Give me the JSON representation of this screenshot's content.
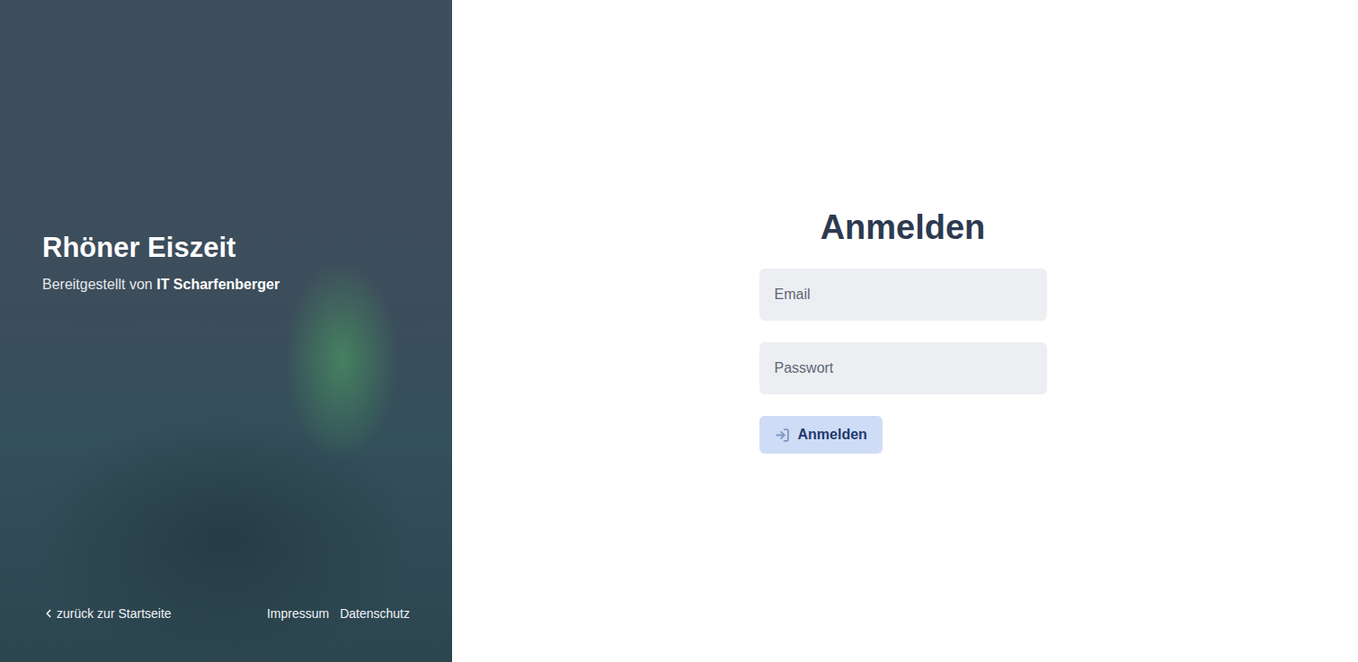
{
  "brand": {
    "title": "Rhöner Eiszeit",
    "subtitle_prefix": "Bereitgestellt von",
    "subtitle_company": "IT Scharfenberger"
  },
  "footer": {
    "back": "zurück zur Startseite",
    "links": [
      "Impressum",
      "Datenschutz"
    ]
  },
  "form": {
    "heading": "Anmelden",
    "fields": [
      {
        "placeholder": "Email",
        "type": "email"
      },
      {
        "placeholder": "Passwort",
        "type": "password"
      }
    ],
    "button": "Anmelden"
  }
}
